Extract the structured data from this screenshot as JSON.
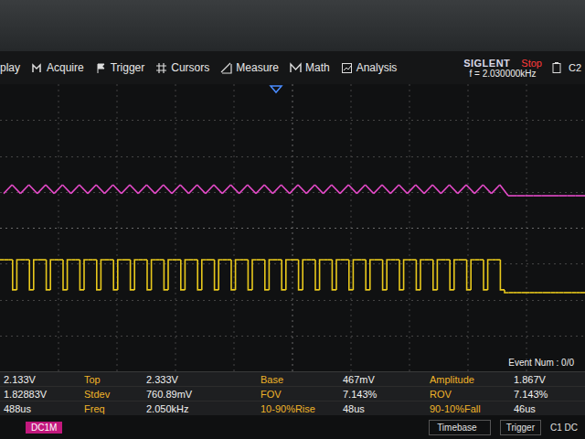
{
  "menu": [
    "play",
    "Acquire",
    "Trigger",
    "Cursors",
    "Measure",
    "Math",
    "Analysis"
  ],
  "brand": "SIGLENT",
  "run_state": "Stop",
  "frequency": "f = 2.030000kHz",
  "channel": "C2",
  "chart": {
    "series": [
      {
        "kind": "line",
        "color": "#e44bc8",
        "values": [
          0.6,
          1.0,
          0.6,
          1.0,
          0.6,
          1.0,
          0.6,
          1.0,
          0.6,
          1.0,
          0.6,
          1.0,
          0.6,
          1.0,
          0.6,
          1.0,
          0.6,
          1.0,
          0.6,
          1.0,
          0.6,
          1.0,
          0.6,
          1.0,
          0.6,
          1.0,
          0.6,
          1.0,
          0.6,
          1.0,
          0.6,
          1.0,
          0.6,
          1.0,
          0.6,
          1.0,
          0.6,
          1.0,
          0.6,
          1.0,
          0.6,
          1.0,
          0.6,
          1.0,
          0.6,
          1.0,
          0.6,
          1.0,
          0.6,
          1.0,
          0.6,
          1.0,
          0.6,
          1.0,
          0.6,
          1.0,
          0.6,
          1.0,
          0.6,
          1.0,
          0.5,
          0.5,
          0.5,
          0.5,
          0.5,
          0.5,
          0.5,
          0.5,
          0.5,
          0.5
        ]
      },
      {
        "kind": "step",
        "color": "#e8c81c",
        "values": [
          2.33,
          2.33,
          2.33,
          0.47,
          2.33,
          2.33,
          2.33,
          0.47,
          2.33,
          2.33,
          2.33,
          0.47,
          2.33,
          2.33,
          2.33,
          0.47,
          2.33,
          2.33,
          2.33,
          0.47,
          2.33,
          2.33,
          2.33,
          0.47,
          2.33,
          2.33,
          2.33,
          0.47,
          2.33,
          2.33,
          2.33,
          0.47,
          2.33,
          2.33,
          2.33,
          0.47,
          2.33,
          2.33,
          2.33,
          0.47,
          2.33,
          2.33,
          2.33,
          0.47,
          2.33,
          2.33,
          2.33,
          0.47,
          2.33,
          2.33,
          2.33,
          0.47,
          2.33,
          2.33,
          2.33,
          0.47,
          2.33,
          2.33,
          2.33,
          0.47,
          2.33,
          2.33,
          2.33,
          0.47,
          2.33,
          2.33,
          2.33,
          0.47,
          2.33,
          2.33,
          2.33,
          0.47,
          2.33,
          2.33,
          2.33,
          0.47,
          2.33,
          2.33,
          2.33,
          0.47,
          2.33,
          2.33,
          2.33,
          0.47,
          2.33,
          2.33,
          2.33,
          0.47,
          2.33,
          2.33,
          2.33,
          0.47,
          2.33,
          2.33,
          2.33,
          0.47,
          2.33,
          2.33,
          2.33,
          0.47,
          2.33,
          2.33,
          2.33,
          0.47,
          2.33,
          2.33,
          2.33,
          0.47,
          2.33,
          2.33,
          2.33,
          0.47,
          2.33,
          2.33,
          2.33,
          0.47,
          2.33,
          2.33,
          2.33,
          0.47,
          0.3,
          0.3,
          0.3,
          0.3,
          0.3,
          0.3,
          0.3,
          0.3,
          0.3,
          0.3,
          0.3,
          0.3,
          0.3,
          0.3,
          0.3,
          0.3,
          0.3,
          0.3,
          0.3
        ]
      }
    ]
  },
  "event": "Event Num : 0/0",
  "measurements": {
    "rows": [
      [
        "2.133V",
        "Top",
        "2.333V",
        "Base",
        "467mV",
        "Amplitude",
        "1.867V"
      ],
      [
        "1.82883V",
        "Stdev",
        "760.89mV",
        "FOV",
        "7.143%",
        "ROV",
        "7.143%"
      ],
      [
        "488us",
        "Freq",
        "2.050kHz",
        "10-90%Rise",
        "48us",
        "90-10%Fall",
        "46us"
      ]
    ]
  },
  "status_bar": {
    "coupling": "DC1M",
    "timebase": "Timebase",
    "trigger": "Trigger",
    "trigger_source": "C1 DC"
  }
}
